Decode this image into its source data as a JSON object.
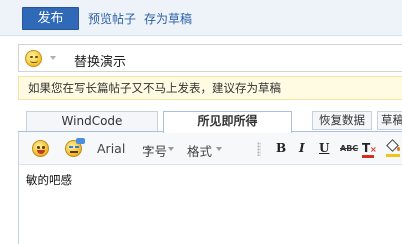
{
  "header": {
    "publish_label": "发布",
    "preview_label": "预览帖子",
    "save_draft_label": "存为草稿"
  },
  "post": {
    "title": "替换演示",
    "notice": "如果您在写长篇帖子又不马上发表，建议存为草稿"
  },
  "tabs": [
    {
      "label": "WindCode",
      "active": false
    },
    {
      "label": "所见即所得",
      "active": true
    }
  ],
  "actions": {
    "restore_label": "恢复数据",
    "draftbox_label": "草稿"
  },
  "toolbar": {
    "font_label": "Arial",
    "size_label": "字号",
    "format_label": "格式",
    "bold": "B",
    "italic": "I",
    "underline": "U",
    "strike": "ABC",
    "text_color": "T",
    "icons": [
      "smiley-icon",
      "emoticon-icon",
      "text-color-icon",
      "background-color-icon"
    ]
  },
  "editor": {
    "content": "敏的吧感"
  },
  "colors": {
    "accent": "#2f69b7",
    "link": "#2b5fa7",
    "notice_bg": "#fffbe3"
  }
}
